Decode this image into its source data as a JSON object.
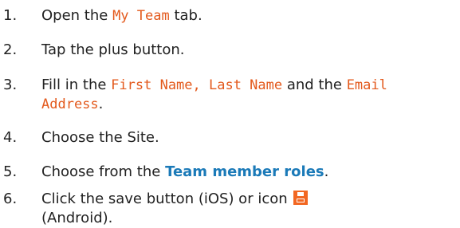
{
  "steps": [
    {
      "num": "1.",
      "pre": "Open the ",
      "hl": "My Team",
      "post": " tab."
    },
    {
      "num": "2.",
      "text": "Tap the plus button."
    },
    {
      "num": "3.",
      "pre": "Fill in the ",
      "hl1": "First Name, Last Name",
      "mid": " and the ",
      "hl2": "Email",
      "hl2b": "Address",
      "post": "."
    },
    {
      "num": "4.",
      "text": "Choose the Site."
    },
    {
      "num": "5.",
      "pre": "Choose from the ",
      "link": "Team member roles",
      "post": "."
    },
    {
      "num": "6.",
      "pre": "Click the save button (iOS) or icon",
      "post": "(Android)."
    }
  ],
  "colors": {
    "highlight": "#e3591c",
    "link": "#1b7ab8",
    "icon": "#f26722"
  },
  "icons": {
    "save": "save-icon"
  }
}
